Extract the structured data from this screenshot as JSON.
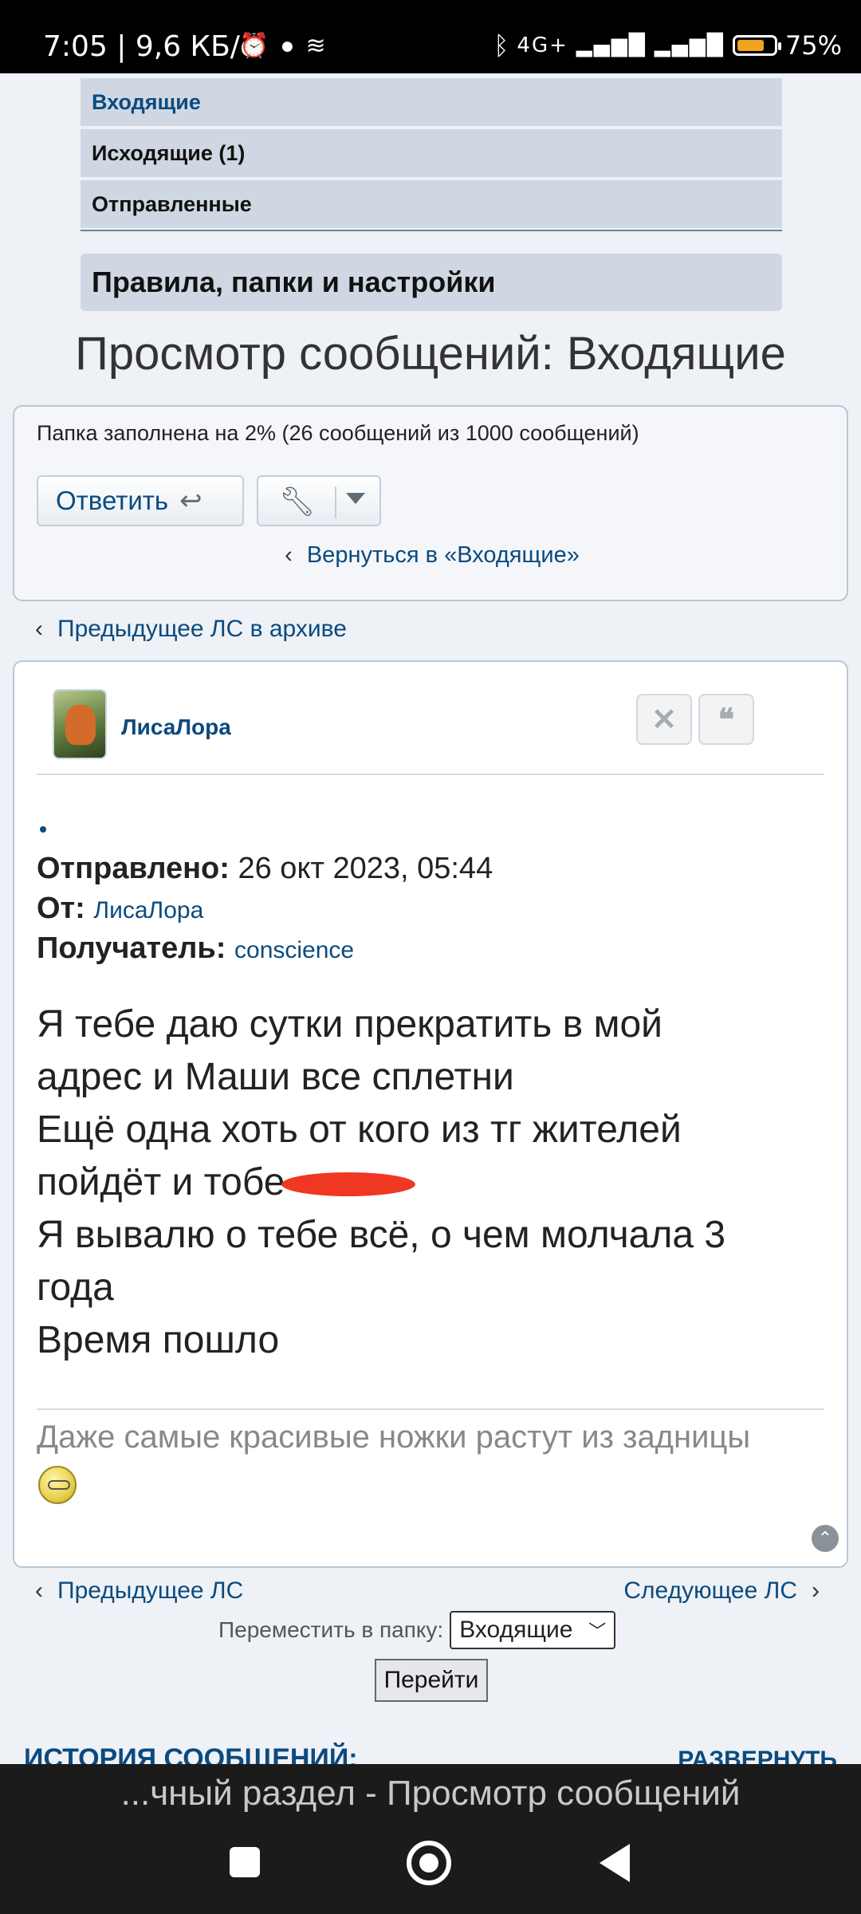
{
  "status_bar": {
    "time_speed": "7:05 | 9,6 КБ/с",
    "network": "4G+",
    "battery": "75%",
    "battery_level": 0.75
  },
  "nav": {
    "items": [
      {
        "label": "Входящие",
        "active": true
      },
      {
        "label": "Исходящие (1)",
        "active": false
      },
      {
        "label": "Отправленные",
        "active": false
      }
    ],
    "rules_label": "Правила, папки и настройки"
  },
  "page_title": "Просмотр сообщений: Входящие",
  "panel": {
    "folder_info": "Папка заполнена на 2% (26 сообщений из 1000 сообщений)",
    "reply_label": "Ответить",
    "back_link": "Вернуться в «Входящие»"
  },
  "prev_archive_link": "Предыдущее ЛС в архиве",
  "message": {
    "author": "ЛисаЛора",
    "sent_label": "Отправлено:",
    "sent_value": "26 окт 2023, 05:44",
    "from_label": "От:",
    "from_value": "ЛисаЛора",
    "to_label": "Получатель:",
    "to_value": "conscience",
    "body_lines": [
      "Я тебе даю сутки прекратить в мой",
      "адрес и Маши все сплетни",
      "Ещё одна хоть от кого из тг жителей",
      "пойдёт и тобе",
      "Я вывалю о тебе всё, о чем молчала 3",
      "года",
      "Время пошло"
    ],
    "signature": "Даже самые красивые ножки растут из задницы"
  },
  "pager": {
    "prev_label": "Предыдущее ЛС",
    "next_label": "Следующее ЛС",
    "move_label": "Переместить в папку:",
    "folder_selected": "Входящие",
    "go_label": "Перейти"
  },
  "history": {
    "title": "ИСТОРИЯ СООБЩЕНИЙ:",
    "expand": "РАЗВЕРНУТЬ"
  },
  "browser": {
    "tab_title": "...чный раздел - Просмотр сообщений"
  },
  "colors": {
    "link": "#0b4a7f",
    "nav_bg": "#cfd8e2",
    "page_bg": "#eef1f5"
  }
}
